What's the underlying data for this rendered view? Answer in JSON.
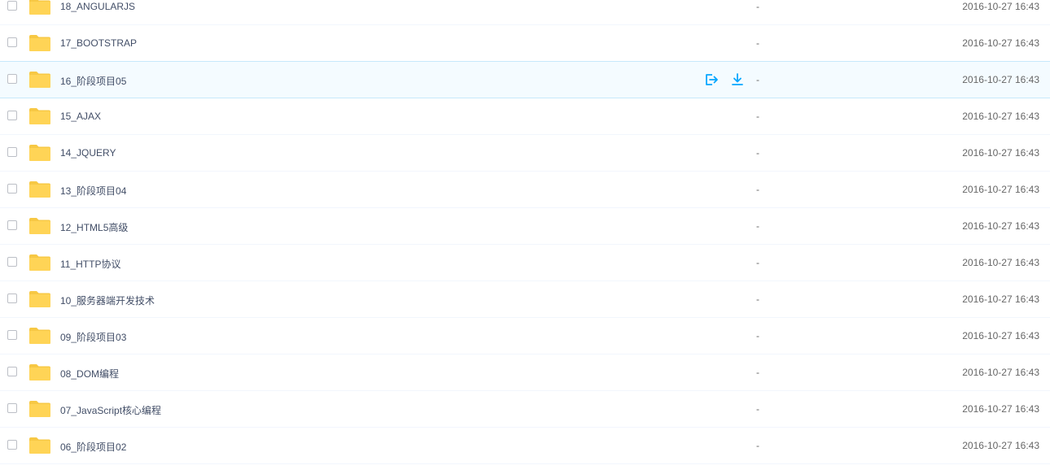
{
  "colors": {
    "folder": "#ffd456",
    "folder_dark": "#f7c844",
    "accent": "#06a7ff",
    "hover_bg": "#f4fbff"
  },
  "icons": {
    "row_share": "share-icon",
    "row_download": "download-icon",
    "row_folder": "folder-icon"
  },
  "files": [
    {
      "name": "18_ANGULARJS",
      "size": "-",
      "date": "2016-10-27 16:43",
      "hover": false
    },
    {
      "name": "17_BOOTSTRAP",
      "size": "-",
      "date": "2016-10-27 16:43",
      "hover": false
    },
    {
      "name": "16_阶段项目05",
      "size": "-",
      "date": "2016-10-27 16:43",
      "hover": true
    },
    {
      "name": "15_AJAX",
      "size": "-",
      "date": "2016-10-27 16:43",
      "hover": false
    },
    {
      "name": "14_JQUERY",
      "size": "-",
      "date": "2016-10-27 16:43",
      "hover": false
    },
    {
      "name": "13_阶段项目04",
      "size": "-",
      "date": "2016-10-27 16:43",
      "hover": false
    },
    {
      "name": "12_HTML5高级",
      "size": "-",
      "date": "2016-10-27 16:43",
      "hover": false
    },
    {
      "name": "11_HTTP协议",
      "size": "-",
      "date": "2016-10-27 16:43",
      "hover": false
    },
    {
      "name": "10_服务器端开发技术",
      "size": "-",
      "date": "2016-10-27 16:43",
      "hover": false
    },
    {
      "name": "09_阶段项目03",
      "size": "-",
      "date": "2016-10-27 16:43",
      "hover": false
    },
    {
      "name": "08_DOM编程",
      "size": "-",
      "date": "2016-10-27 16:43",
      "hover": false
    },
    {
      "name": "07_JavaScript核心编程",
      "size": "-",
      "date": "2016-10-27 16:43",
      "hover": false
    },
    {
      "name": "06_阶段项目02",
      "size": "-",
      "date": "2016-10-27 16:43",
      "hover": false
    }
  ]
}
